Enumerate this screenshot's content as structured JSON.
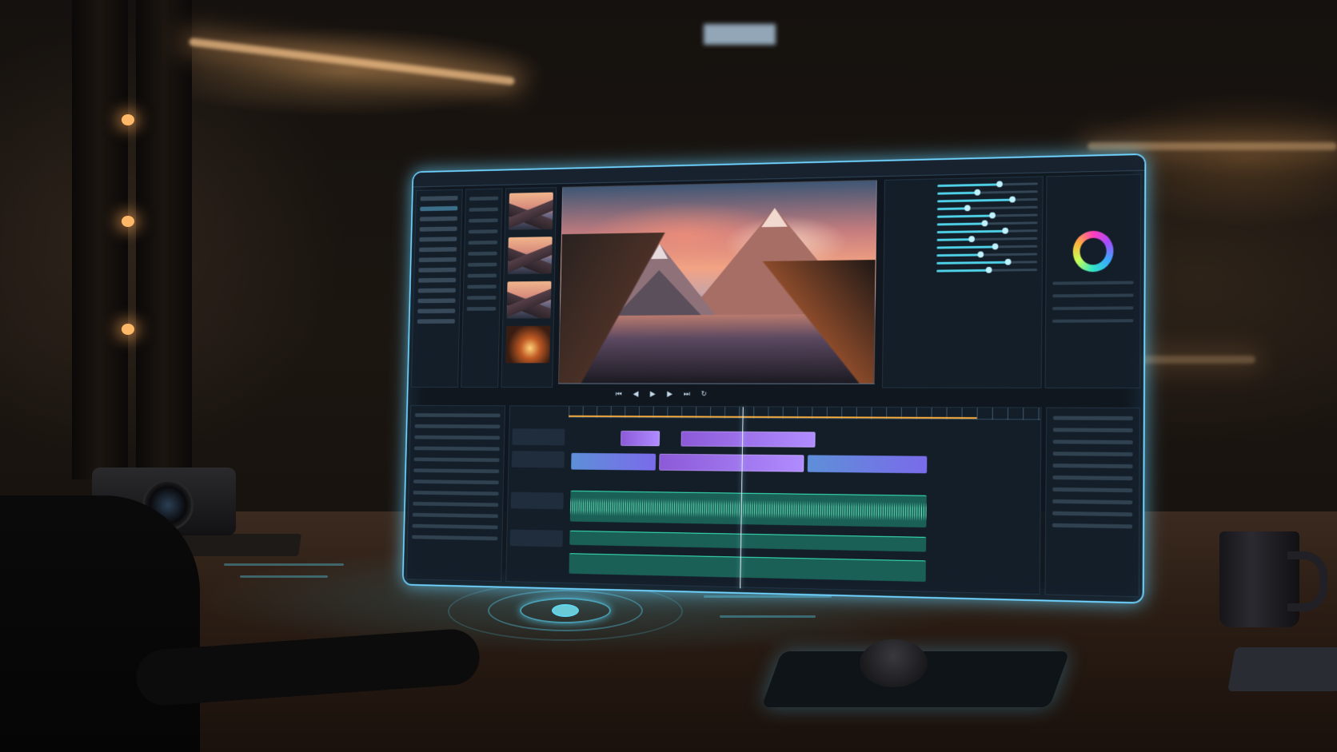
{
  "app": {
    "menus": [
      "",
      "",
      "",
      "",
      ""
    ],
    "window_title": ""
  },
  "sidebar": {
    "items": [
      {
        "selected": false
      },
      {
        "selected": true
      },
      {
        "selected": false
      },
      {
        "selected": false
      },
      {
        "selected": false
      },
      {
        "selected": false
      },
      {
        "selected": false
      },
      {
        "selected": false
      },
      {
        "selected": false
      },
      {
        "selected": false
      },
      {
        "selected": false
      },
      {
        "selected": false
      },
      {
        "selected": false
      }
    ]
  },
  "media_pool": {
    "thumbnails": [
      {
        "subject": "mountain-sunset-thumbnail"
      },
      {
        "subject": "mountain-sunset-thumbnail"
      },
      {
        "subject": "mountain-sunset-thumbnail"
      },
      {
        "subject": "campfire-thumbnail"
      }
    ]
  },
  "viewer": {
    "subject": "mountain-lake-sunset-frame"
  },
  "inspector": {
    "rows": [
      {
        "label": "",
        "value": 0.62
      },
      {
        "label": "",
        "value": 0.4
      },
      {
        "label": "",
        "value": 0.75
      },
      {
        "label": "",
        "value": 0.3
      },
      {
        "label": "",
        "value": 0.55
      },
      {
        "label": "",
        "value": 0.48
      },
      {
        "label": "",
        "value": 0.68
      },
      {
        "label": "",
        "value": 0.35
      },
      {
        "label": "",
        "value": 0.58
      },
      {
        "label": "",
        "value": 0.44
      },
      {
        "label": "",
        "value": 0.71
      },
      {
        "label": "",
        "value": 0.52
      }
    ]
  },
  "color_wheel": {
    "icon": "color-wheel-icon"
  },
  "transport": {
    "timecode": "",
    "controls": [
      {
        "name": "skip-back-icon",
        "glyph": "⏮"
      },
      {
        "name": "step-back-icon",
        "glyph": "◀"
      },
      {
        "name": "play-icon",
        "glyph": "▶"
      },
      {
        "name": "step-forward-icon",
        "glyph": "▶"
      },
      {
        "name": "skip-forward-icon",
        "glyph": "⏭"
      },
      {
        "name": "loop-icon",
        "glyph": "↻"
      }
    ]
  },
  "timeline": {
    "tracks": [
      {
        "kind": "video",
        "label": ""
      },
      {
        "kind": "video",
        "label": ""
      },
      {
        "kind": "audio",
        "label": ""
      },
      {
        "kind": "audio",
        "label": ""
      }
    ]
  },
  "colors": {
    "accent": "#6fd2ff",
    "video_clip": "#9b6cf0",
    "audio_clip": "#39f0c0",
    "playhead": "#f3f6ff",
    "in_out_range": "#ffae3b"
  }
}
